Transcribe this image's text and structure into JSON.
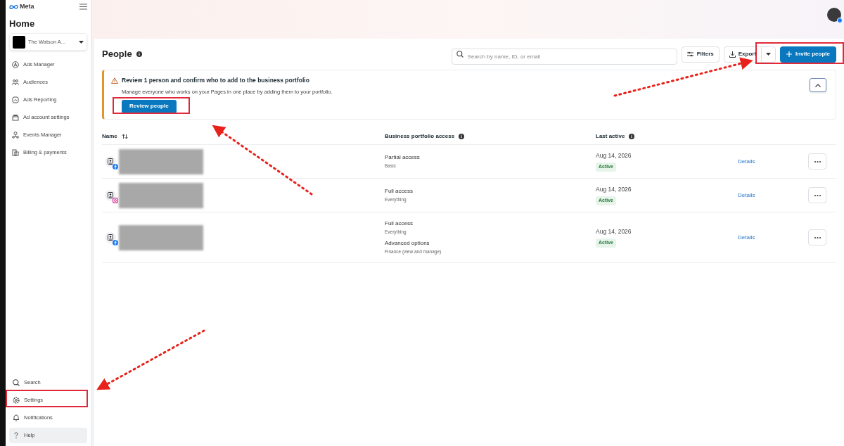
{
  "sidebar": {
    "logo": "Meta",
    "title": "Home",
    "account": {
      "name": "The Watson A..."
    },
    "items": [
      {
        "label": "Ads Manager"
      },
      {
        "label": "Audiences"
      },
      {
        "label": "Ads Reporting"
      },
      {
        "label": "Ad account settings"
      },
      {
        "label": "Events Manager"
      },
      {
        "label": "Billing & payments"
      }
    ],
    "bottom_items": [
      {
        "label": "Search",
        "selected": false
      },
      {
        "label": "Settings",
        "selected": false
      },
      {
        "label": "Notifications",
        "selected": false
      },
      {
        "label": "Help",
        "selected": true
      }
    ]
  },
  "page": {
    "title": "People",
    "search": {
      "placeholder": "Search by name, ID, or email"
    },
    "filters": "Filters",
    "export": "Export",
    "invite": "Invite people"
  },
  "banner": {
    "title": "Review 1 person and confirm who to add to the business portfolio",
    "text": "Manage everyone who works on your Pages in one place by adding them to your portfolio.",
    "button": "Review people",
    "expanded": true
  },
  "table": {
    "columns": [
      "Name",
      "Business portfolio access",
      "Last active"
    ],
    "rows": [
      {
        "kind": "facebook",
        "access": [
          {
            "level": "Partial access",
            "detail": "Basic"
          }
        ],
        "last_active": "Aug 14, 2026",
        "status": "Active",
        "action": "Details"
      },
      {
        "kind": "instagram",
        "access": [
          {
            "level": "Full access",
            "detail": "Everything"
          }
        ],
        "last_active": "Aug 14, 2026",
        "status": "Active",
        "action": "Details"
      },
      {
        "kind": "facebook",
        "access": [
          {
            "level": "Full access",
            "detail": "Everything"
          },
          {
            "level": "Advanced options",
            "detail": "Finance (view and manage)"
          }
        ],
        "last_active": "Aug 14, 2026",
        "status": "Active",
        "action": "Details"
      }
    ]
  }
}
